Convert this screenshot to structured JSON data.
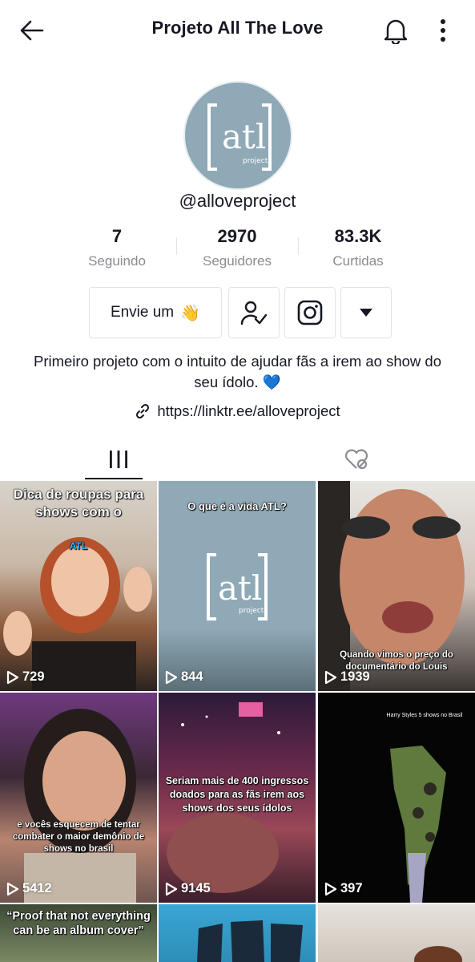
{
  "header": {
    "title": "Projeto All The Love",
    "back_icon": "back-arrow-icon",
    "bell_icon": "bell-icon",
    "more_icon": "more-vertical-icon"
  },
  "profile": {
    "handle": "@alloveproject",
    "avatar_text_main": "atl",
    "avatar_text_sub": "project",
    "bio": "Primeiro projeto com o intuito de ajudar fãs a irem ao show do seu ídolo. 💙",
    "link": "https://linktr.ee/alloveproject",
    "avatar_color": "#8fa9b7"
  },
  "stats": [
    {
      "value": "7",
      "label": "Seguindo"
    },
    {
      "value": "2970",
      "label": "Seguidores"
    },
    {
      "value": "83.3K",
      "label": "Curtidas"
    }
  ],
  "actions": {
    "message_label": "Envie um",
    "message_emoji": "👋",
    "follow_icon": "friends-check-icon",
    "instagram_icon": "instagram-icon",
    "dropdown_icon": "triangle-down-icon"
  },
  "tabs": [
    {
      "name": "videos",
      "icon": "grid-bars-icon",
      "active": true
    },
    {
      "name": "liked",
      "icon": "liked-hidden-icon",
      "active": false
    }
  ],
  "videos": [
    {
      "views": "729",
      "caption": "Dica de roupas para shows com o",
      "badge": "ATL"
    },
    {
      "views": "844",
      "caption": "O que é a vida ATL?"
    },
    {
      "views": "1939",
      "caption": "Quando vimos o preço do documentário do Louis"
    },
    {
      "views": "5412",
      "caption": "e vocês esquecem de tentar combater o maior demônio de shows no brasil"
    },
    {
      "views": "9145",
      "caption": "Seriam mais de 400 ingressos doados para as fãs irem aos shows dos seus ídolos"
    },
    {
      "views": "397",
      "caption": "Harry Styles 5 shows no Brasil"
    },
    {
      "views": "",
      "caption": "“Proof that not everything can be an album cover”"
    },
    {
      "views": "",
      "caption": ""
    },
    {
      "views": "",
      "caption": ""
    }
  ],
  "colors": {
    "text": "#161823",
    "secondary": "#8a8b91",
    "border": "#e3e3e4"
  }
}
